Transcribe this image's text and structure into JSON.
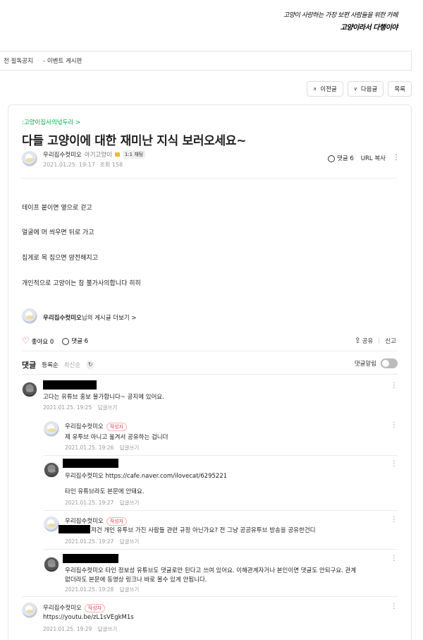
{
  "banner": {
    "slogan_line1": "고양이 사랑하는 가장 보편 사람들을 위한 카페",
    "slogan_line2": "고양이라서 다행이야"
  },
  "breadcrumb": {
    "item1": "전 필독공지",
    "separator": "·",
    "item2": "- 이벤트 게시판"
  },
  "nav": {
    "prev_label": "이전글",
    "next_label": "다음글",
    "list_label": "목록"
  },
  "post": {
    "cafe_link": ":고양이집사의넋두리 >",
    "title": "다들 고양이에 대한 재미난 지식 보러오세요~",
    "author": "우리집수컷미오",
    "author_level": "아기고양이",
    "chat_badge": "1:1 채팅",
    "date": "2021.01.25. 19:17",
    "views": "조회 158",
    "comment_count_label": "댓글 6",
    "url_copy": "URL 복사",
    "body": [
      "테이프 붙이면 옆으로 걷고",
      "얼굴에 머 씌우면 뒤로 가고",
      "집게로 목 집으면 얌전해지고",
      "개인적으로 고양이는 참 불가사의합니다 히히"
    ],
    "more_posts_name": "우리집수컷미오",
    "more_posts_suffix": "님의 게시글 더보기 >",
    "like_label": "좋아요 0",
    "comment_label": "댓글 6",
    "share_label": "공유",
    "report_label": "신고"
  },
  "comments_section": {
    "title": "댓글",
    "sort_registered": "등록순",
    "sort_latest": "최신순",
    "refresh_icon": "refresh-icon",
    "notify_label": "댓글알림",
    "notify_on": false,
    "writer_badge": "작성자",
    "reply_label": "답글쓰기",
    "comments": [
      {
        "name": "",
        "text": "고다는 유튜브 홍보 불가합니다~ 공지에 있어요.",
        "date": "2021.01.25. 19:25"
      },
      {
        "name": "우리집수컷미오",
        "text": "제 유투브 아니고 옮겨서 공유하는 겁니더",
        "date": "2021.01.25. 19:26"
      },
      {
        "name": "",
        "mention": "우리집수컷미오",
        "text": "https://cafe.naver.com/ilovecat/6295221",
        "text2": "타인 유튜브라도 본문에 안돼요.",
        "date": "2021.01.25. 19:27"
      },
      {
        "name": "우리집수컷미오",
        "text": "저건 개인 유투브 가진 사람들 관련 규정 아닌가요? 전 그냥 공공유투브 방송을 공유한건디",
        "date": "2021.01.25. 19:27"
      },
      {
        "name": "",
        "mention": "우리집수컷미오",
        "text": "타인 정보성 유튜브도 댓글로만 된다고 쓰여 있어요. 이해관계자거나 본인이면 댓글도 안되구요. 관계",
        "text2": "없더라도 본문에 동영상 링크나 바로 볼수 있게 안됩니다.",
        "date": "2021.01.25. 19:28"
      },
      {
        "name": "우리집수컷미오",
        "text": "https://youtu.be/zL1sVEgkM1s",
        "date": "2021.01.25. 19:29"
      }
    ]
  }
}
